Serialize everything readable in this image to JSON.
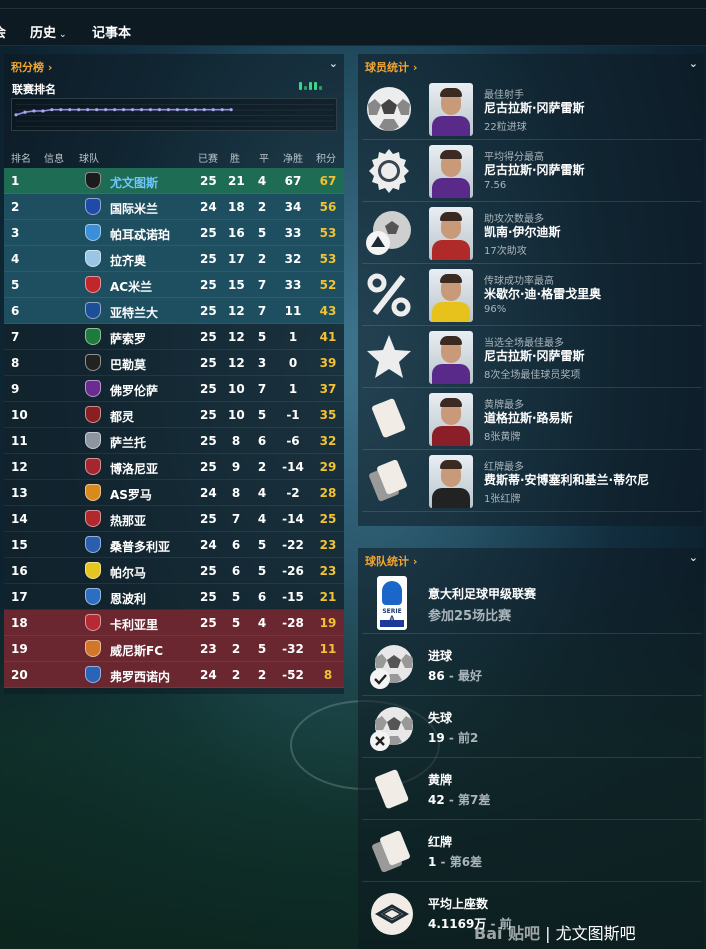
{
  "nav": {
    "cut_label": "会",
    "history": "历史",
    "notebook": "记事本"
  },
  "standings_panel": {
    "title": "积分榜 ›",
    "chart_title": "联赛排名",
    "headers": {
      "pos": "排名",
      "info": "信息",
      "team": "球队",
      "played": "已赛",
      "won": "胜",
      "drawn": "平",
      "gd": "净胜",
      "pts": "积分"
    },
    "rows": [
      {
        "pos": "1",
        "team": "尤文图斯",
        "pl": "25",
        "w": "21",
        "d": "4",
        "gd": "67",
        "pts": "67",
        "crest": "#1b1b1b"
      },
      {
        "pos": "2",
        "team": "国际米兰",
        "pl": "24",
        "w": "18",
        "d": "2",
        "gd": "34",
        "pts": "56",
        "crest": "#1f4aa8"
      },
      {
        "pos": "3",
        "team": "帕耳忒诺珀",
        "pl": "25",
        "w": "16",
        "d": "5",
        "gd": "33",
        "pts": "53",
        "crest": "#3a8fd8"
      },
      {
        "pos": "4",
        "team": "拉齐奥",
        "pl": "25",
        "w": "17",
        "d": "2",
        "gd": "32",
        "pts": "53",
        "crest": "#9ac6e6"
      },
      {
        "pos": "5",
        "team": "AC米兰",
        "pl": "25",
        "w": "15",
        "d": "7",
        "gd": "33",
        "pts": "52",
        "crest": "#c0262c"
      },
      {
        "pos": "6",
        "team": "亚特兰大",
        "pl": "25",
        "w": "12",
        "d": "7",
        "gd": "11",
        "pts": "43",
        "crest": "#1d4f99"
      },
      {
        "pos": "7",
        "team": "萨索罗",
        "pl": "25",
        "w": "12",
        "d": "5",
        "gd": "1",
        "pts": "41",
        "crest": "#1e7a3d"
      },
      {
        "pos": "8",
        "team": "巴勒莫",
        "pl": "25",
        "w": "12",
        "d": "3",
        "gd": "0",
        "pts": "39",
        "crest": "#222222"
      },
      {
        "pos": "9",
        "team": "佛罗伦萨",
        "pl": "25",
        "w": "10",
        "d": "7",
        "gd": "1",
        "pts": "37",
        "crest": "#6a2c91"
      },
      {
        "pos": "10",
        "team": "都灵",
        "pl": "25",
        "w": "10",
        "d": "5",
        "gd": "-1",
        "pts": "35",
        "crest": "#8a1f22"
      },
      {
        "pos": "11",
        "team": "萨兰托",
        "pl": "25",
        "w": "8",
        "d": "6",
        "gd": "-6",
        "pts": "32",
        "crest": "#8c95a0"
      },
      {
        "pos": "12",
        "team": "博洛尼亚",
        "pl": "25",
        "w": "9",
        "d": "2",
        "gd": "-14",
        "pts": "29",
        "crest": "#a5262e"
      },
      {
        "pos": "13",
        "team": "AS罗马",
        "pl": "24",
        "w": "8",
        "d": "4",
        "gd": "-2",
        "pts": "28",
        "crest": "#d98a1c"
      },
      {
        "pos": "14",
        "team": "热那亚",
        "pl": "25",
        "w": "7",
        "d": "4",
        "gd": "-14",
        "pts": "25",
        "crest": "#b3282d"
      },
      {
        "pos": "15",
        "team": "桑普多利亚",
        "pl": "24",
        "w": "6",
        "d": "5",
        "gd": "-22",
        "pts": "23",
        "crest": "#2a5fb0"
      },
      {
        "pos": "16",
        "team": "帕尔马",
        "pl": "25",
        "w": "6",
        "d": "5",
        "gd": "-26",
        "pts": "23",
        "crest": "#e6c51f"
      },
      {
        "pos": "17",
        "team": "恩波利",
        "pl": "25",
        "w": "5",
        "d": "6",
        "gd": "-15",
        "pts": "21",
        "crest": "#2c6fc2"
      },
      {
        "pos": "18",
        "team": "卡利亚里",
        "pl": "25",
        "w": "5",
        "d": "4",
        "gd": "-28",
        "pts": "19",
        "crest": "#b72a35"
      },
      {
        "pos": "19",
        "team": "威尼斯FC",
        "pl": "23",
        "w": "2",
        "d": "5",
        "gd": "-32",
        "pts": "11",
        "crest": "#d2762a"
      },
      {
        "pos": "20",
        "team": "弗罗西诺内",
        "pl": "24",
        "w": "2",
        "d": "2",
        "gd": "-52",
        "pts": "8",
        "crest": "#2a63b8"
      }
    ],
    "zone_colors": {
      "first": "#1f6c55",
      "ucl": "#1e4f60",
      "relegation": "#6a2730",
      "neutral": "#1a2f3a"
    },
    "rank_history": [
      11,
      9,
      8,
      8,
      7,
      7,
      7,
      7,
      7,
      7,
      7,
      7,
      7,
      7,
      7,
      7,
      7,
      7,
      7,
      7,
      7,
      7,
      7,
      7,
      7
    ]
  },
  "player_panel": {
    "title": "球员统计 ›",
    "rows": [
      {
        "label": "最佳射手",
        "name": "尼古拉斯·冈萨雷斯",
        "value": "22粒进球",
        "icon": "soccer-ball-icon",
        "kit": "#5a2a8a"
      },
      {
        "label": "平均得分最高",
        "name": "尼古拉斯·冈萨雷斯",
        "value": "7.56",
        "icon": "medal-icon",
        "kit": "#5a2a8a"
      },
      {
        "label": "助攻次数最多",
        "name": "凯南·伊尔迪斯",
        "value": "17次助攻",
        "icon": "assist-icon",
        "kit": "#b02a2a"
      },
      {
        "label": "传球成功率最高",
        "name": "米歇尔·迪·格雷戈里奥",
        "value": "96%",
        "icon": "percent-icon",
        "kit": "#e8c21c"
      },
      {
        "label": "当选全场最佳最多",
        "name": "尼古拉斯·冈萨雷斯",
        "value": "8次全场最佳球员奖项",
        "icon": "star-icon",
        "kit": "#5a2a8a"
      },
      {
        "label": "黄牌最多",
        "name": "道格拉斯·路易斯",
        "value": "8张黄牌",
        "icon": "yellow-card-icon",
        "kit": "#8a1f2a"
      },
      {
        "label": "红牌最多",
        "name": "费斯蒂·安博塞利和基兰·蒂尔尼",
        "value": "1张红牌",
        "icon": "red-card-icon",
        "kit": "#222222"
      }
    ]
  },
  "team_panel": {
    "title": "球队统计 ›",
    "league": {
      "name": "意大利足球甲级联赛",
      "sub": "参加25场比赛"
    },
    "goals": {
      "title": "进球",
      "value": "86",
      "rank": " - 最好"
    },
    "conceded": {
      "title": "失球",
      "value": "19",
      "rank": " - 前2"
    },
    "yellow": {
      "title": "黄牌",
      "value": "42",
      "rank": " - 第7差"
    },
    "red": {
      "title": "红牌",
      "value": "1",
      "rank": " - 第6差"
    },
    "attendance": {
      "title": "平均上座数",
      "value": "4.1169万",
      "rank": " - 前"
    }
  },
  "watermark": {
    "logo": "Bai 贴吧",
    "text": "| 尤文图斯吧"
  }
}
